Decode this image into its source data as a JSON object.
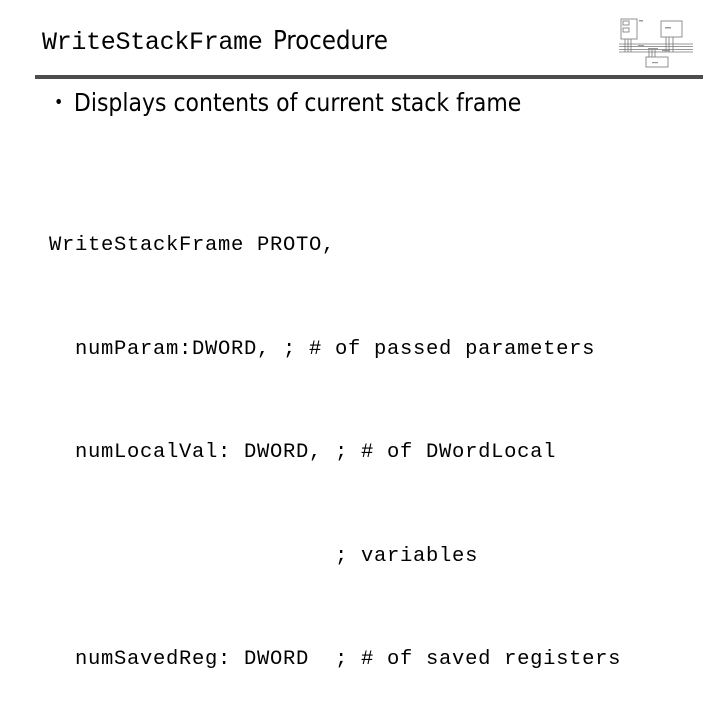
{
  "slide": {
    "title_code": "WriteStackFrame",
    "title_text": "Procedure",
    "bullets": [
      "Displays contents of current stack frame"
    ],
    "code_lines": [
      "WriteStackFrame PROTO,",
      "  numParam:DWORD, ; # of passed parameters",
      "  numLocalVal: DWORD, ; # of DWordLocal",
      "                      ; variables",
      "  numSavedReg: DWORD  ; # of saved registers"
    ],
    "icons": {
      "diagram": "computer-architecture-diagram-icon"
    },
    "colors": {
      "divider": "#4d4d4d",
      "text": "#000000",
      "background": "#ffffff"
    }
  }
}
